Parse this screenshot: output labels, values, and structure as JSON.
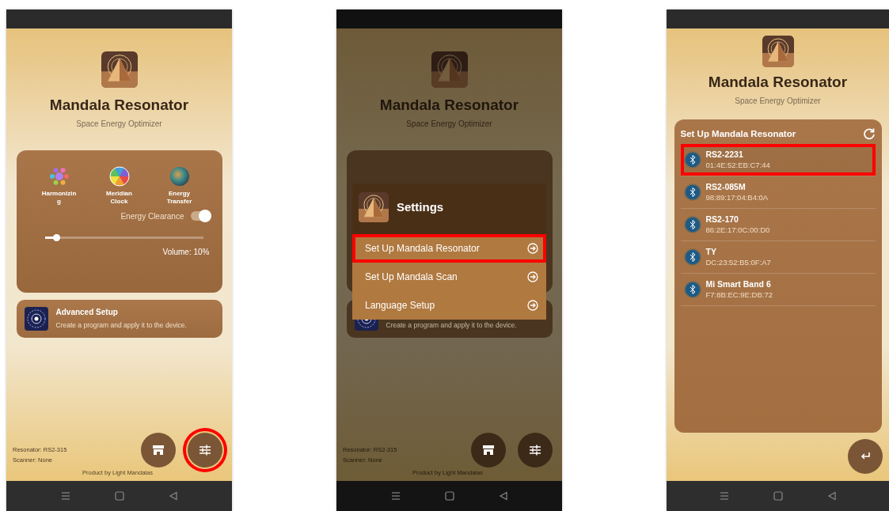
{
  "screens": [
    {
      "kind": "home",
      "dimmed": false,
      "app_title": "Mandala Resonator",
      "subtitle": "Space Energy Optimizer",
      "modes": [
        {
          "kind": "flower",
          "label": "Harmonizing"
        },
        {
          "kind": "wheel",
          "label": "Meridian Clock"
        },
        {
          "kind": "orb",
          "label": "Energy Transfer"
        }
      ],
      "toggle": {
        "label": "Energy Clearance",
        "on": true
      },
      "volume": {
        "level": 0.07,
        "reading": "Volume: 10%"
      },
      "advanced": {
        "title": "Advanced Setup",
        "description": "Create a program and apply it to the device."
      },
      "status_lines": [
        "Resonator: RS2-315",
        "Scanner: None"
      ],
      "buttons": [
        {
          "kind": "store",
          "highlighted": false
        },
        {
          "kind": "settings",
          "highlighted": true
        }
      ],
      "credit": "Product by Light Mandalas"
    },
    {
      "kind": "home",
      "dimmed": true,
      "app_title": "Mandala Resonator",
      "subtitle": "Space Energy Optimizer",
      "advanced": {
        "description": "Create a program and apply it to the device."
      },
      "status_lines": [
        "Resonator: RS2-315",
        "Scanner: None"
      ],
      "buttons": [
        {
          "kind": "store",
          "highlighted": false
        },
        {
          "kind": "settings",
          "highlighted": false
        }
      ],
      "credit": "Product by Light Mandalas",
      "dialog": {
        "title": "Settings",
        "items": [
          {
            "label": "Set Up Mandala Resonator",
            "highlighted": true
          },
          {
            "label": "Set Up Mandala Scan",
            "highlighted": false
          },
          {
            "label": "Language Setup",
            "highlighted": false
          }
        ]
      }
    },
    {
      "kind": "devices",
      "dimmed": false,
      "app_title": "Mandala Resonator",
      "subtitle": "Space Energy Optimizer",
      "panel": {
        "title": "Set Up Mandala Resonator",
        "devices": [
          {
            "name": "RS2-2231",
            "address": "01:4E:52:EB:C7:44",
            "highlighted": true
          },
          {
            "name": "RS2-085M",
            "address": "98:89:17:04:B4:0A",
            "highlighted": false
          },
          {
            "name": "RS2-170",
            "address": "86:2E:17:0C:00:D0",
            "highlighted": false
          },
          {
            "name": "TY",
            "address": "DC:23:52:B5:0F:A7",
            "highlighted": false
          },
          {
            "name": "Mi Smart Band 6",
            "address": "F7:8B:EC:9E:DB:72",
            "highlighted": false
          }
        ]
      }
    }
  ]
}
